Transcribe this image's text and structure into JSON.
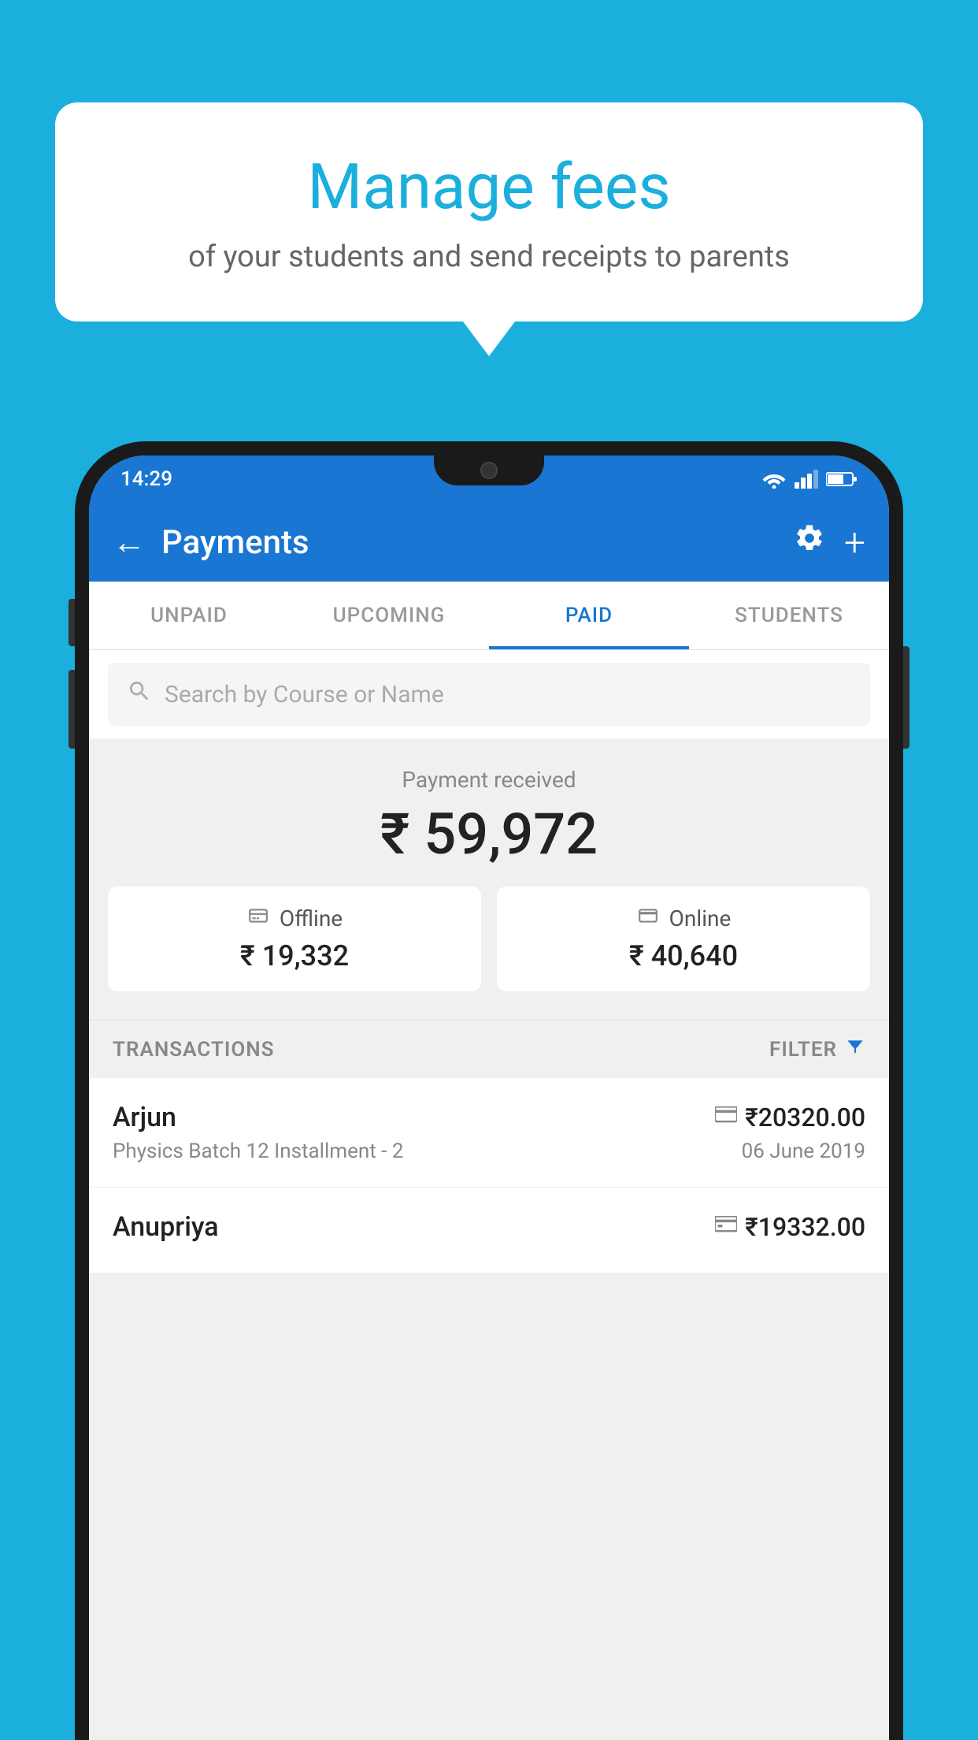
{
  "bubble": {
    "title": "Manage fees",
    "subtitle": "of your students and send receipts to parents"
  },
  "phone": {
    "status_bar": {
      "time": "14:29"
    },
    "header": {
      "title": "Payments",
      "back_label": "←",
      "settings_label": "⚙",
      "add_label": "+"
    },
    "tabs": [
      {
        "label": "UNPAID",
        "active": false
      },
      {
        "label": "UPCOMING",
        "active": false
      },
      {
        "label": "PAID",
        "active": true
      },
      {
        "label": "STUDENTS",
        "active": false
      }
    ],
    "search": {
      "placeholder": "Search by Course or Name"
    },
    "payment_summary": {
      "label": "Payment received",
      "amount": "₹ 59,972",
      "offline": {
        "type": "Offline",
        "amount": "₹ 19,332"
      },
      "online": {
        "type": "Online",
        "amount": "₹ 40,640"
      }
    },
    "transactions": {
      "header_label": "TRANSACTIONS",
      "filter_label": "FILTER",
      "items": [
        {
          "name": "Arjun",
          "course": "Physics Batch 12 Installment - 2",
          "amount": "₹20320.00",
          "date": "06 June 2019",
          "payment_method": "online"
        },
        {
          "name": "Anupriya",
          "course": "",
          "amount": "₹19332.00",
          "date": "",
          "payment_method": "offline"
        }
      ]
    }
  }
}
